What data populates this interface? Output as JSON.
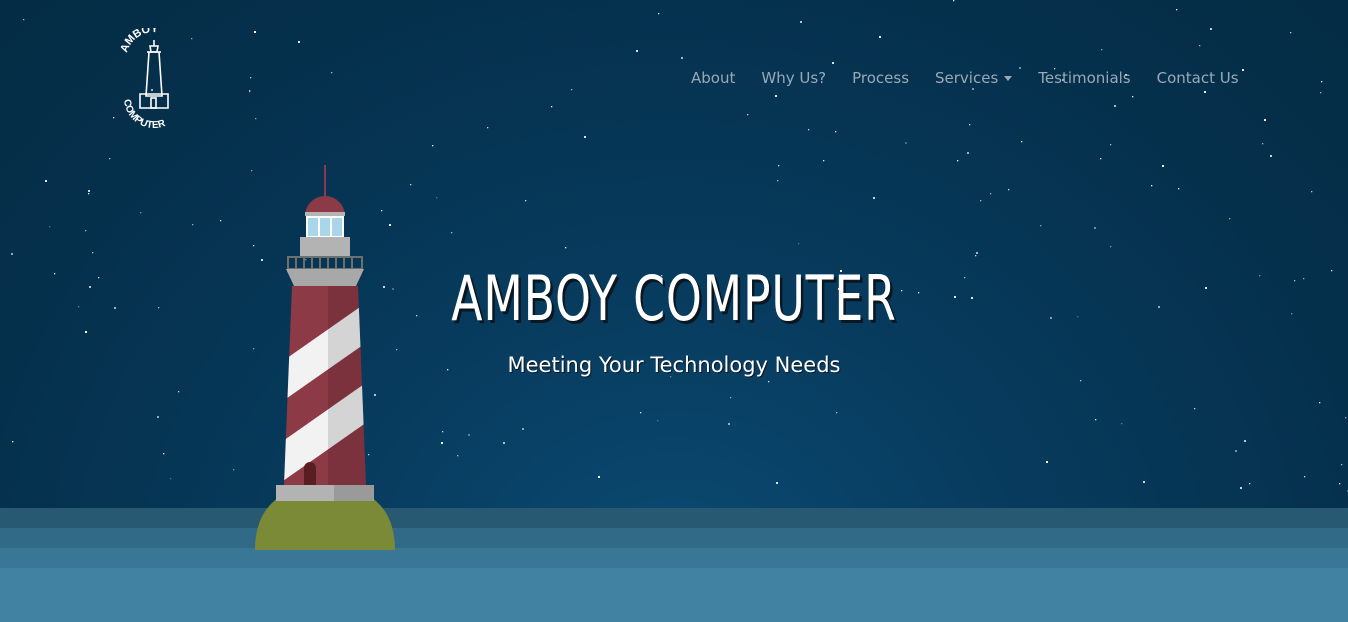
{
  "brand": {
    "logo_top_text": "AMBOY",
    "logo_bottom_text": "COMPUTER"
  },
  "nav": {
    "items": [
      {
        "label": "About"
      },
      {
        "label": "Why Us?"
      },
      {
        "label": "Process"
      },
      {
        "label": "Services"
      },
      {
        "label": "Testimonials"
      },
      {
        "label": "Contact Us"
      }
    ]
  },
  "hero": {
    "title": "AMBOY COMPUTER",
    "subtitle": "Meeting Your Technology Needs"
  },
  "colors": {
    "sky": "#05304c",
    "sea_band_1": "#275a72",
    "sea_band_2": "#306a86",
    "sea_band_3": "#3a7796",
    "sea_band_4": "#4182a2",
    "island": "#7a8a36",
    "stripe_red": "#8c3a45",
    "stripe_white": "#f2f2f2",
    "nav_text": "#9aa9b6"
  }
}
